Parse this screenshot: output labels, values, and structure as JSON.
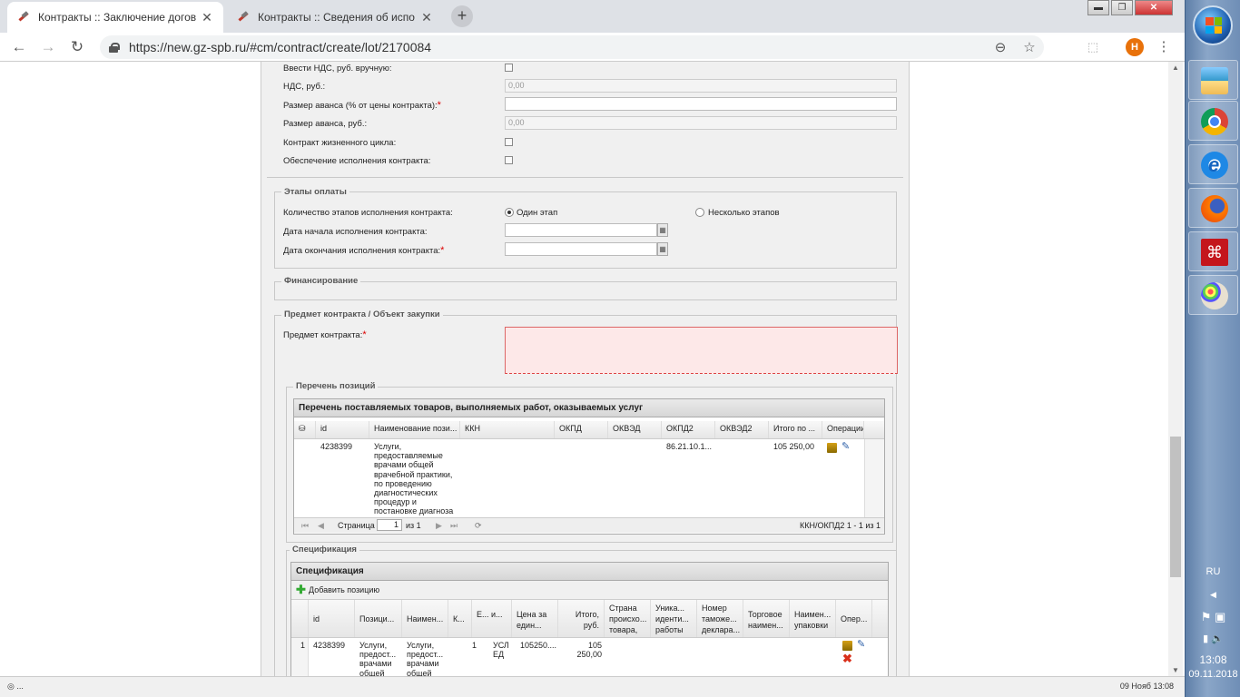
{
  "tabs": [
    {
      "title": "Контракты :: Заключение догов",
      "active": true
    },
    {
      "title": "Контракты :: Сведения об испо",
      "active": false
    }
  ],
  "window_controls": {
    "minimize": "▬",
    "maximize": "❐",
    "close": "✕"
  },
  "address_bar": {
    "url": "https://new.gz-spb.ru/#cm/contract/create/lot/2170084"
  },
  "profile_initial": "Н",
  "form": {
    "rows": [
      {
        "label": "Ввести НДС, руб. вручную:",
        "type": "checkbox"
      },
      {
        "label": "НДС, руб.:",
        "type": "input",
        "value": "0,00",
        "disabled": true
      },
      {
        "label": "Размер аванса (% от цены контракта):",
        "required": true,
        "type": "input",
        "value": ""
      },
      {
        "label": "Размер аванса, руб.:",
        "type": "input",
        "value": "0,00",
        "disabled": true
      },
      {
        "label": "Контракт жизненного цикла:",
        "type": "checkbox"
      },
      {
        "label": "Обеспечение исполнения контракта:",
        "type": "checkbox"
      }
    ],
    "payment_stages": {
      "legend": "Этапы оплаты",
      "count_label": "Количество этапов исполнения контракта:",
      "option_one": "Один этап",
      "option_many": "Несколько этапов",
      "start_label": "Дата начала исполнения контракта:",
      "end_label": "Дата окончания исполнения контракта:"
    },
    "financing": {
      "legend": "Финансирование"
    },
    "subject": {
      "legend": "Предмет контракта / Объект закупки",
      "subject_label": "Предмет контракта:",
      "positions_legend": "Перечень позиций",
      "positions_grid": {
        "title": "Перечень поставляемых товаров, выполняемых работ, оказываемых услуг",
        "columns": [
          "id",
          "Наименование пози...",
          "ККН",
          "ОКПД",
          "ОКВЭД",
          "ОКПД2",
          "ОКВЭД2",
          "Итого по ...",
          "Операции"
        ],
        "rows": [
          {
            "id": "4238399",
            "name": "Услуги, предоставляемые врачами общей врачебной практики, по проведению диагностических процедур и постановке диагноза",
            "kkn": "",
            "okpd": "",
            "okved": "",
            "okpd2": "86.21.10.1...",
            "okved2": "",
            "total": "105 250,00"
          }
        ],
        "pager": {
          "page_label": "Страница",
          "page": "1",
          "of_label": "из 1",
          "summary": "ККН/ОКПД2 1 - 1 из 1"
        }
      },
      "spec_legend": "Спецификация",
      "spec_grid": {
        "title": "Спецификация",
        "add_label": "Добавить позицию",
        "columns": [
          "id",
          "Позици...",
          "Наимен...",
          "К...",
          "Е... и...",
          "Цена за един...",
          "Итого, руб.",
          "Страна происхо... товара, ...",
          "Уника... иденти... работы ...",
          "Номер таможе... деклара...",
          "Торговое наимен...",
          "Наимен... упаковки",
          "Опер..."
        ],
        "rows": [
          {
            "n": "1",
            "id": "4238399",
            "pos": "Услуги, предост... врачами общей",
            "name": "Услуги, предост... врачами общей",
            "qty": "1",
            "unit": "УСЛ ЕД",
            "price": "105250....",
            "total": "105 250,00"
          }
        ]
      }
    }
  },
  "status": {
    "left": "◎ ...",
    "right": "09 Нояб 13:08"
  },
  "taskbar": {
    "lang": "RU",
    "time": "13:08",
    "date": "09.11.2018",
    "apps": [
      "file-manager",
      "chrome",
      "internet-explorer",
      "firefox",
      "acrobat",
      "paint"
    ]
  }
}
